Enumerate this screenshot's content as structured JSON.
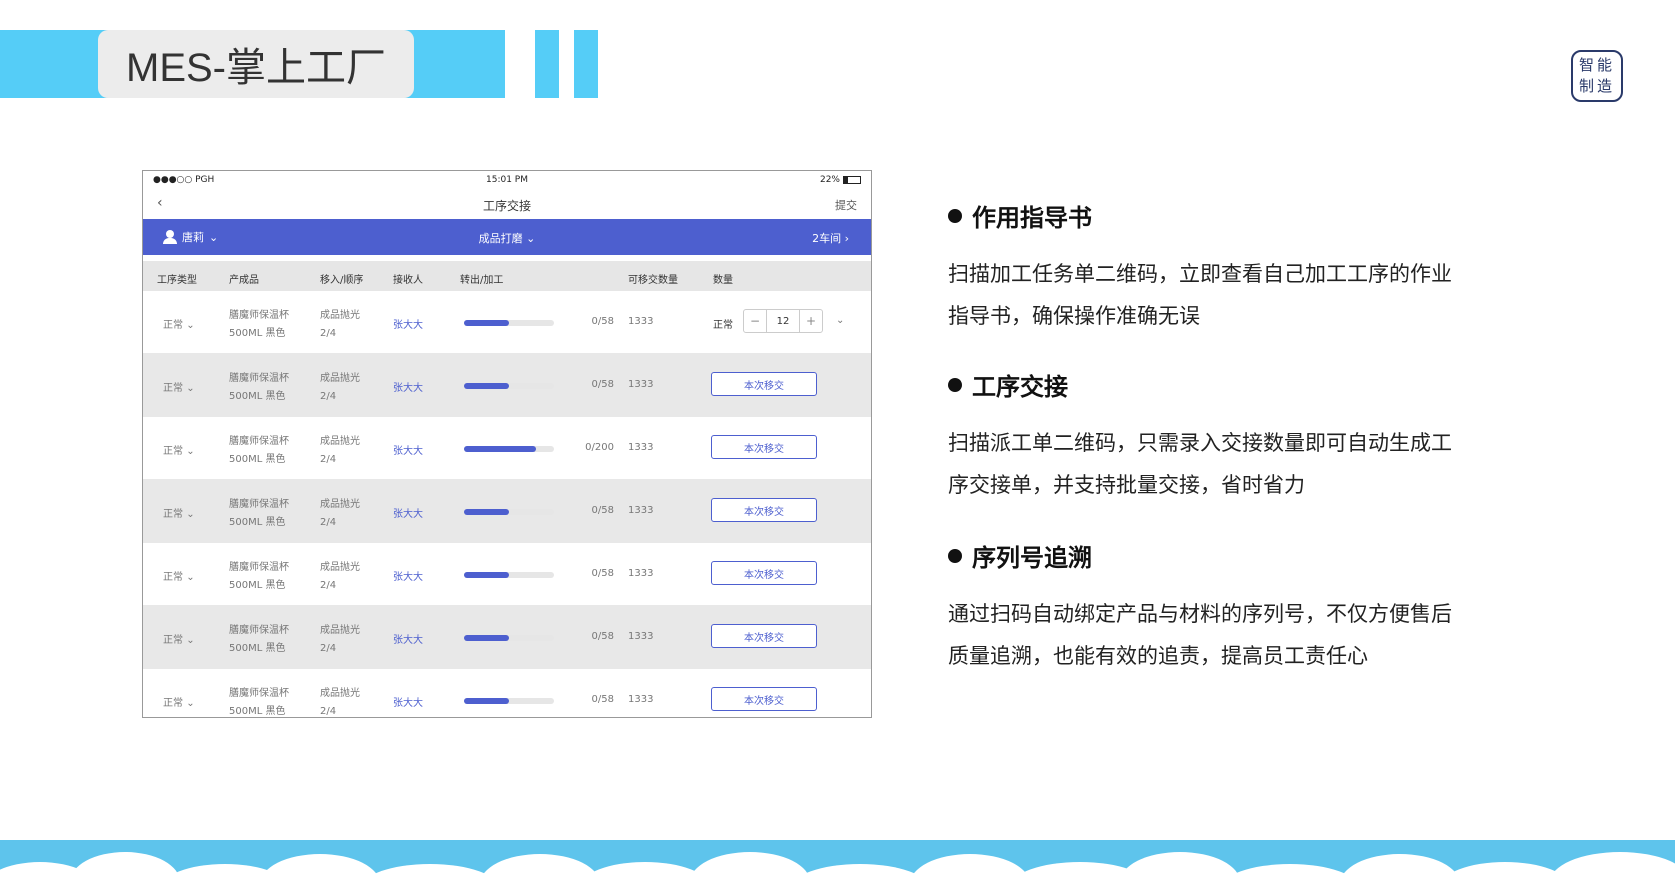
{
  "header": {
    "title": "MES-掌上工厂",
    "seal_lines": [
      "智能",
      "制造"
    ]
  },
  "phone": {
    "status": {
      "carrier": "●●●○○ PGH",
      "time": "15:01 PM",
      "battery": "22%"
    },
    "nav": {
      "back": "‹",
      "title": "工序交接",
      "submit": "提交"
    },
    "filter": {
      "user": "唐莉",
      "process": "成品打磨",
      "workshop": "2车间"
    },
    "columns": [
      "工序类型",
      "产成品",
      "移入/顺序",
      "接收人",
      "转出/加工",
      "可移交数量",
      "数量"
    ],
    "rows": [
      {
        "type": "正常",
        "product_line1": "膳魔师保温杯",
        "product_line2": "500ML 黑色",
        "step_line1": "成品抛光",
        "step_line2": "2/4",
        "receiver": "张大大",
        "progress": 0.5,
        "ratio": "0/58",
        "available": "1333",
        "qty_status": "正常",
        "qty_value": "12",
        "mode": "stepper"
      },
      {
        "type": "正常",
        "product_line1": "膳魔师保温杯",
        "product_line2": "500ML 黑色",
        "step_line1": "成品抛光",
        "step_line2": "2/4",
        "receiver": "张大大",
        "progress": 0.5,
        "ratio": "0/58",
        "available": "1333",
        "button": "本次移交",
        "mode": "button"
      },
      {
        "type": "正常",
        "product_line1": "膳魔师保温杯",
        "product_line2": "500ML 黑色",
        "step_line1": "成品抛光",
        "step_line2": "2/4",
        "receiver": "张大大",
        "progress": 0.8,
        "ratio": "0/200",
        "available": "1333",
        "button": "本次移交",
        "mode": "button"
      },
      {
        "type": "正常",
        "product_line1": "膳魔师保温杯",
        "product_line2": "500ML 黑色",
        "step_line1": "成品抛光",
        "step_line2": "2/4",
        "receiver": "张大大",
        "progress": 0.5,
        "ratio": "0/58",
        "available": "1333",
        "button": "本次移交",
        "mode": "button"
      },
      {
        "type": "正常",
        "product_line1": "膳魔师保温杯",
        "product_line2": "500ML 黑色",
        "step_line1": "成品抛光",
        "step_line2": "2/4",
        "receiver": "张大大",
        "progress": 0.5,
        "ratio": "0/58",
        "available": "1333",
        "button": "本次移交",
        "mode": "button"
      },
      {
        "type": "正常",
        "product_line1": "膳魔师保温杯",
        "product_line2": "500ML 黑色",
        "step_line1": "成品抛光",
        "step_line2": "2/4",
        "receiver": "张大大",
        "progress": 0.5,
        "ratio": "0/58",
        "available": "1333",
        "button": "本次移交",
        "mode": "button"
      },
      {
        "type": "正常",
        "product_line1": "膳魔师保温杯",
        "product_line2": "500ML 黑色",
        "step_line1": "成品抛光",
        "step_line2": "2/4",
        "receiver": "张大大",
        "progress": 0.5,
        "ratio": "0/58",
        "available": "1333",
        "button": "本次移交",
        "mode": "button"
      }
    ]
  },
  "features": [
    {
      "title": "作用指导书",
      "desc_line1": "扫描加工任务单二维码，立即查看自己加工工序的作业",
      "desc_line2": "指导书，确保操作准确无误"
    },
    {
      "title": "工序交接",
      "desc_line1": "扫描派工单二维码，只需录入交接数量即可自动生成工",
      "desc_line2": "序交接单，并支持批量交接，省时省力"
    },
    {
      "title": "序列号追溯",
      "desc_line1": "通过扫码自动绑定产品与材料的序列号，不仅方便售后",
      "desc_line2": "质量追溯，也能有效的追责，提高员工责任心"
    }
  ],
  "colors": {
    "accent": "#55cdf7",
    "brand_blue": "#4d5fcf"
  }
}
